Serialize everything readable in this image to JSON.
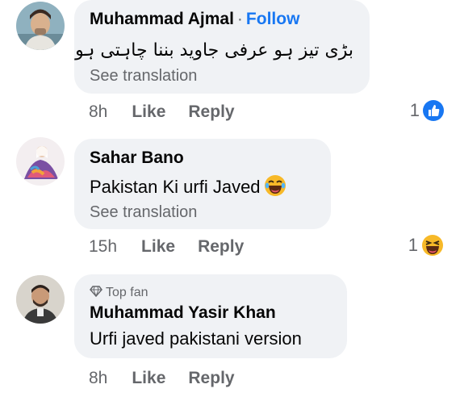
{
  "comments": [
    {
      "author": "Muhammad Ajmal",
      "follow_separator": "·",
      "follow_label": "Follow",
      "text": "بڑی تیز ہو عرفی جاوید بننا چاہتی ہو",
      "see_translation": "See translation",
      "time": "8h",
      "like_label": "Like",
      "reply_label": "Reply",
      "reaction_count": "1",
      "reaction_icon": "like-reaction-icon",
      "avatar_icon": "profile-avatar-icon"
    },
    {
      "author": "Sahar Bano",
      "text": "Pakistan Ki urfi Javed",
      "text_emoji": "laughing-emoji-icon",
      "see_translation": "See translation",
      "time": "15h",
      "like_label": "Like",
      "reply_label": "Reply",
      "reaction_count": "1",
      "reaction_icon": "haha-reaction-icon",
      "avatar_icon": "profile-avatar-icon"
    },
    {
      "badge": "Top fan",
      "badge_icon": "diamond-icon",
      "author": "Muhammad Yasir Khan",
      "text": "Urfi javed pakistani version",
      "time": "8h",
      "like_label": "Like",
      "reply_label": "Reply",
      "avatar_icon": "profile-avatar-icon"
    }
  ],
  "colors": {
    "bubble": "#f0f2f5",
    "link_blue": "#1877f2",
    "secondary_text": "#65676b",
    "haha_yellow": "#f7b928"
  }
}
